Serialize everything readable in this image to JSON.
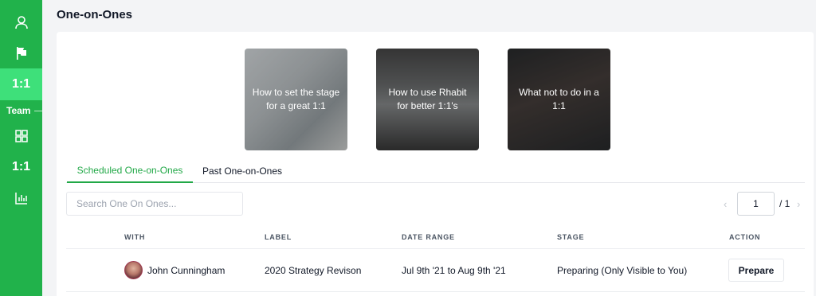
{
  "sidebar": {
    "icons": [
      "user-icon",
      "flag-icon",
      "grid-icon",
      "bar-chart-icon"
    ],
    "one_on_one_label": "1:1",
    "team_label": "Team",
    "team_one_on_one_label": "1:1",
    "brand_color": "#21b24b",
    "active_color": "#3ee07a"
  },
  "page": {
    "title": "One-on-Ones"
  },
  "guides": [
    {
      "title": "How to set the stage for a great 1:1"
    },
    {
      "title": "How to use Rhabit for better 1:1's"
    },
    {
      "title": "What not to do in a 1:1"
    }
  ],
  "tabs": [
    {
      "label": "Scheduled One-on-Ones",
      "active": true
    },
    {
      "label": "Past One-on-Ones",
      "active": false
    }
  ],
  "search": {
    "placeholder": "Search One On Ones...",
    "value": ""
  },
  "pagination": {
    "current": "1",
    "total_label": "/ 1",
    "prev_icon": "chevron-left-icon",
    "next_icon": "chevron-right-icon"
  },
  "table": {
    "columns": [
      "WITH",
      "LABEL",
      "DATE RANGE",
      "STAGE",
      "ACTION"
    ],
    "rows": [
      {
        "with": "John Cunningham",
        "label": "2020 Strategy Revison",
        "date_range": "Jul 9th '21 to Aug 9th '21",
        "stage": "Preparing (Only Visible to You)",
        "action": "Prepare"
      }
    ]
  }
}
